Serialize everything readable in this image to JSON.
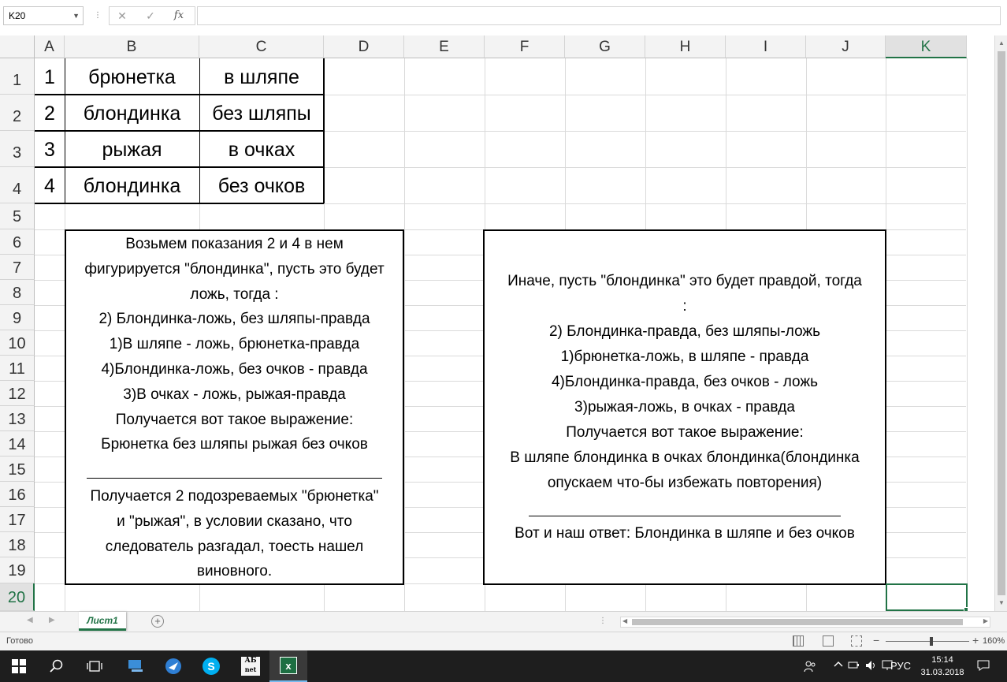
{
  "formula_bar": {
    "name_box": "K20",
    "cancel_icon": "✕",
    "enter_icon": "✓",
    "fx_label": "fx",
    "formula": ""
  },
  "columns": [
    "A",
    "B",
    "C",
    "D",
    "E",
    "F",
    "G",
    "H",
    "I",
    "J",
    "K"
  ],
  "rows": [
    "1",
    "2",
    "3",
    "4",
    "5",
    "6",
    "7",
    "8",
    "9",
    "10",
    "11",
    "12",
    "13",
    "14",
    "15",
    "16",
    "17",
    "18",
    "19",
    "20"
  ],
  "active_column": "K",
  "active_row": "20",
  "table": [
    [
      "1",
      "брюнетка",
      "в шляпе"
    ],
    [
      "2",
      "блондинка",
      "без шляпы"
    ],
    [
      "3",
      "рыжая",
      "в очках"
    ],
    [
      "4",
      "блондинка",
      "без очков"
    ]
  ],
  "textbox_left": {
    "lines_top": [
      "Возьмем показания 2 и 4 в нем",
      "фигурируется \"блондинка\", пусть это будет",
      "ложь, тогда :",
      "2) Блондинка-ложь, без шляпы-правда",
      "1)В шляпе - ложь,  брюнетка-правда",
      "4)Блондинка-ложь, без очков - правда",
      "3)В очках - ложь, рыжая-правда",
      "Получается вот такое выражение:",
      "Брюнетка без шляпы рыжая без очков"
    ],
    "lines_bottom": [
      "Получается 2 подозреваемых \"брюнетка\"",
      "и \"рыжая\", в условии сказано, что",
      "следователь разгадал, тоесть нашел",
      "виновного."
    ]
  },
  "textbox_right": {
    "lines_top": [
      "Иначе, пусть \"блондинка\" это будет правдой, тогда",
      ":",
      "2) Блондинка-правда, без шляпы-ложь",
      "1)брюнетка-ложь,  в шляпе - правда",
      "4)Блондинка-правда, без очков - ложь",
      "3)рыжая-ложь, в очках - правда",
      "Получается вот такое выражение:",
      "В шляпе блондинка в очках блондинка(блондинка",
      "опускаем что-бы избежать повторения)"
    ],
    "lines_bottom": [
      "Вот и наш ответ: Блондинка в шляпе и без очков"
    ]
  },
  "sheet_tabs": [
    "Лист1"
  ],
  "add_sheet_icon": "+",
  "status": {
    "text": "Готово",
    "zoom_minus": "−",
    "zoom_plus": "+",
    "zoom_level": "160%"
  },
  "taskbar": {
    "tray_lang": "РУС",
    "time": "15:14",
    "date": "31.03.2018",
    "skype_label": "S",
    "excel_label": "x",
    "abc_label": "АБ",
    "abc_sub": "net"
  },
  "colors": {
    "accent": "#217346",
    "header_bg": "#f3f3f3",
    "gridline": "#dadada",
    "taskbar": "#1e1e1e"
  }
}
